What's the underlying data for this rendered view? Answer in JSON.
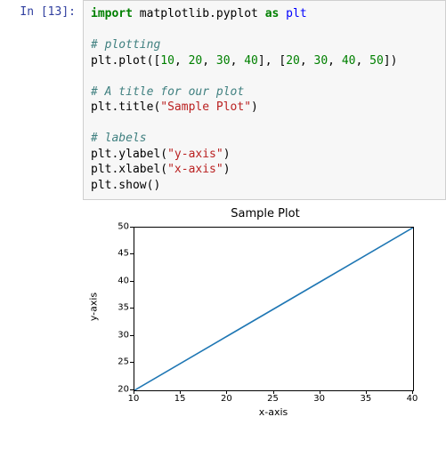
{
  "cell": {
    "prompt": "In [13]:",
    "code": {
      "l1_import": "import",
      "l1_mod": " matplotlib.pyplot ",
      "l1_as": "as",
      "l1_alias": " plt",
      "c1": "# plotting",
      "l2a": "plt.plot([",
      "n1": "10",
      "s1": ", ",
      "n2": "20",
      "s2": ", ",
      "n3": "30",
      "s3": ", ",
      "n4": "40",
      "l2b": "], [",
      "n5": "20",
      "s4": ", ",
      "n6": "30",
      "s5": ", ",
      "n7": "40",
      "s6": ", ",
      "n8": "50",
      "l2c": "])",
      "c2": "# A title for our plot",
      "l3a": "plt.title(",
      "str1": "\"Sample Plot\"",
      "l3b": ")",
      "c3": "# labels",
      "l4a": "plt.ylabel(",
      "str2": "\"y-axis\"",
      "l4b": ")",
      "l5a": "plt.xlabel(",
      "str3": "\"x-axis\"",
      "l5b": ")",
      "l6": "plt.show()"
    }
  },
  "chart_data": {
    "type": "line",
    "title": "Sample Plot",
    "xlabel": "x-axis",
    "ylabel": "y-axis",
    "x": [
      10,
      20,
      30,
      40
    ],
    "y": [
      20,
      30,
      40,
      50
    ],
    "xticks": [
      10,
      15,
      20,
      25,
      30,
      35,
      40
    ],
    "yticks": [
      20,
      25,
      30,
      35,
      40,
      45,
      50
    ],
    "xlim": [
      10,
      40
    ],
    "ylim": [
      20,
      50
    ],
    "line_color": "#1f77b4"
  }
}
